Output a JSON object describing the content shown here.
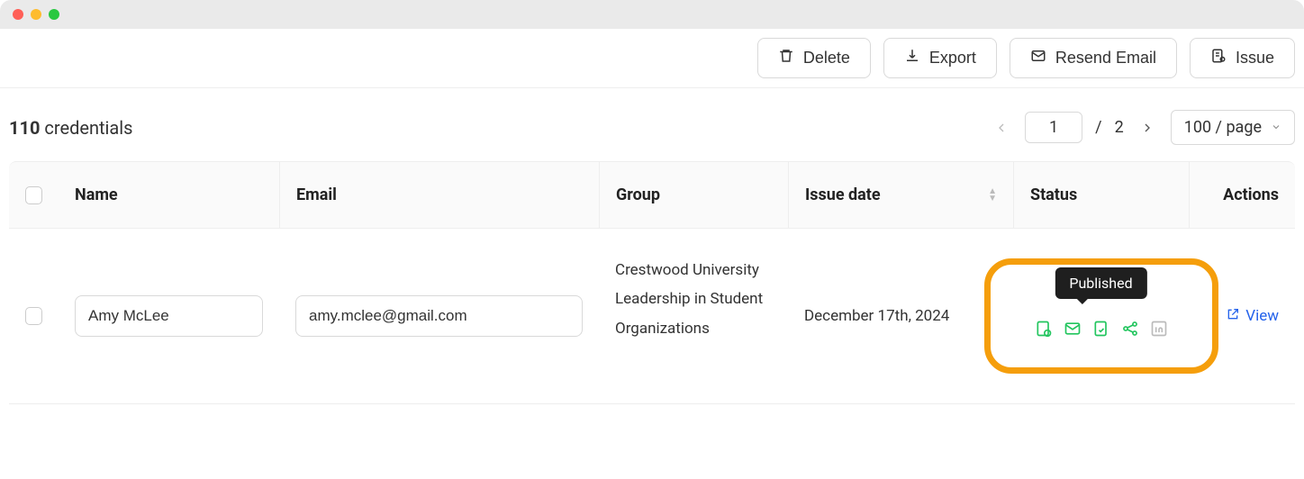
{
  "toolbar": {
    "delete_label": "Delete",
    "export_label": "Export",
    "resend_label": "Resend Email",
    "issue_label": "Issue"
  },
  "summary": {
    "count": "110",
    "count_label": "credentials"
  },
  "pagination": {
    "current": "1",
    "total": "2",
    "per_page_label": "100 / page"
  },
  "columns": {
    "name": "Name",
    "email": "Email",
    "group": "Group",
    "issue_date": "Issue date",
    "status": "Status",
    "actions": "Actions"
  },
  "rows": [
    {
      "name": "Amy McLee",
      "email": "amy.mclee@gmail.com",
      "group": "Crestwood University Leadership in Student Organizations",
      "issue_date": "December 17th, 2024",
      "status_tooltip": "Published",
      "view_label": "View"
    }
  ]
}
